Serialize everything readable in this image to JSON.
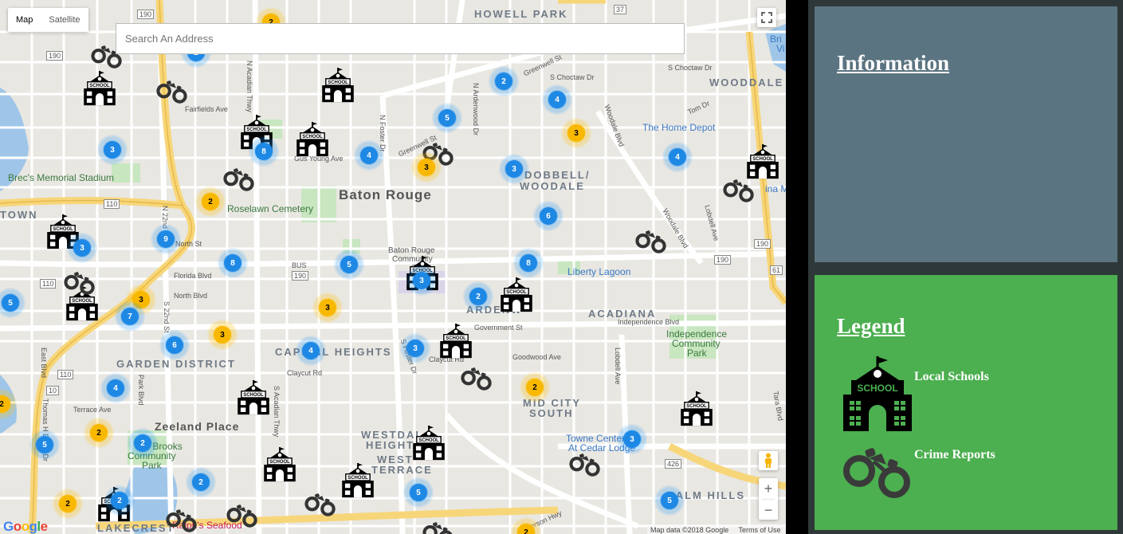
{
  "map": {
    "maptype_tabs": [
      {
        "label": "Map",
        "active": true
      },
      {
        "label": "Satellite",
        "active": false
      }
    ],
    "search": {
      "placeholder": "Search An Address",
      "value": ""
    },
    "zoom_in": "+",
    "zoom_out": "−",
    "attribution": {
      "data": "Map data ©2018 Google",
      "terms": "Terms of Use"
    },
    "google_logo": "Google",
    "labels": {
      "howell_park": "HOWELL PARK",
      "woodale": "WOODDALE",
      "baton_rouge": "Baton Rouge",
      "brecs": "Brec's Memorial Stadium",
      "roselawn": "Roselawn Cemetery",
      "home_depot": "The Home Depot",
      "bri": "Bri",
      "vi": "Vi",
      "ina_mall": "ina Mall",
      "town": "TOWN",
      "liberty_lagoon": "Liberty Lagoon",
      "ardenwood": "ARDENW",
      "acadiana": "ACADIANA",
      "independence_park_1": "Independence",
      "independence_park_2": "Community",
      "independence_park_3": "Park",
      "capital_heights": "CAPITAL HEIGHTS",
      "garden_district": "GARDEN DISTRICT",
      "mid_city_south_1": "MID CITY",
      "mid_city_south_2": "SOUTH",
      "zeeland_place": "Zeeland Place",
      "westdale_1": "WESTDAL",
      "westdale_2": "HEIGHT",
      "westdale_terrace_1": "WEST",
      "westdale_terrace_2": "TERRACE",
      "brooks_1": "Od Brooks",
      "brooks_2": "Community",
      "brooks_3": "Park",
      "towne_center": "Towne Center",
      "cedar_lodge": "At Cedar Lodge",
      "palm_hills": "PALM HILLS",
      "lakecrest": "LAKECREST",
      "seafood": "Ralph's Seafood",
      "dobbell_1": "DOBBELL/",
      "dobbell_2": "WOODALE",
      "br_cc_1": "Baton Rouge",
      "br_cc_2": "Community",
      "br_cc_3": "C",
      "fairfields": "Fairfields Ave",
      "gus_young": "Gus Young Ave",
      "north_st": "North St",
      "florida_blvd": "Florida Blvd",
      "north_blvd": "North Blvd",
      "government_st": "Government St",
      "goodwood": "Goodwood Ave",
      "claycut": "Claycut Rd",
      "claycut2": "Claycut Rd",
      "terrace_ave": "Terrace Ave",
      "s_choctaw": "S Choctaw Dr",
      "s_choctaw2": "S Choctaw Dr",
      "independence_blvd": "Independence Blvd",
      "greenwell": "Greenwell St",
      "greenwell2": "Greenwell St",
      "tom_dr": "Tom Dr",
      "n_foster": "N Foster Dr",
      "n_ardenwood": "N Ardenwood Dr",
      "woodale_blvd": "Woodale Blvd",
      "woodale_blvd2": "Woodale Blvd",
      "n_acadian": "N Acadian Thwy",
      "n_22nd": "N 22nd St",
      "s_22nd": "S 22nd St",
      "s_acadian": "S Acadian Thwy",
      "park_blvd": "Park Blvd",
      "east_blvd": "East Blvd",
      "thomas_delpit": "Thomas H Delpit Dr",
      "s_foster": "S Foster Dr",
      "lobdell": "Lobdell Ave",
      "lobdell2": "Lobdell Ave",
      "tara_blvd": "Tara Blvd",
      "jefferson": "Jefferson Hwy",
      "hwy_110": "110",
      "hwy_110b": "110",
      "hwy_110c": "110",
      "hwy_190a": "190",
      "hwy_190b": "190",
      "hwy_190c": "190",
      "hwy_190d": "190",
      "hwy_190e": "190",
      "hwy_61": "61",
      "hwy_426": "426",
      "hwy_10": "10",
      "hwy_37": "37",
      "hwy_bus": "BUS"
    },
    "clusters": [
      {
        "count": "2",
        "color": "yellow"
      },
      {
        "count": "2",
        "color": "blue"
      },
      {
        "count": "2",
        "color": "blue"
      },
      {
        "count": "4",
        "color": "blue"
      },
      {
        "count": "5",
        "color": "blue"
      },
      {
        "count": "3",
        "color": "yellow"
      },
      {
        "count": "3",
        "color": "blue"
      },
      {
        "count": "8",
        "color": "blue"
      },
      {
        "count": "4",
        "color": "blue"
      },
      {
        "count": "3",
        "color": "yellow"
      },
      {
        "count": "3",
        "color": "blue"
      },
      {
        "count": "4",
        "color": "blue"
      },
      {
        "count": "2",
        "color": "yellow"
      },
      {
        "count": "6",
        "color": "blue"
      },
      {
        "count": "9",
        "color": "blue"
      },
      {
        "count": "3",
        "color": "blue"
      },
      {
        "count": "8",
        "color": "blue"
      },
      {
        "count": "5",
        "color": "blue"
      },
      {
        "count": "8",
        "color": "blue"
      },
      {
        "count": "3",
        "color": "blue"
      },
      {
        "count": "2",
        "color": "blue"
      },
      {
        "count": "3",
        "color": "yellow"
      },
      {
        "count": "3",
        "color": "yellow"
      },
      {
        "count": "5",
        "color": "blue"
      },
      {
        "count": "7",
        "color": "blue"
      },
      {
        "count": "6",
        "color": "blue"
      },
      {
        "count": "3",
        "color": "yellow"
      },
      {
        "count": "4",
        "color": "blue"
      },
      {
        "count": "3",
        "color": "blue"
      },
      {
        "count": "4",
        "color": "blue"
      },
      {
        "count": "2",
        "color": "yellow"
      },
      {
        "count": "2",
        "color": "yellow"
      },
      {
        "count": "2",
        "color": "yellow"
      },
      {
        "count": "2",
        "color": "blue"
      },
      {
        "count": "5",
        "color": "blue"
      },
      {
        "count": "2",
        "color": "blue"
      },
      {
        "count": "2",
        "color": "yellow"
      },
      {
        "count": "2",
        "color": "blue"
      },
      {
        "count": "5",
        "color": "blue"
      },
      {
        "count": "3",
        "color": "blue"
      },
      {
        "count": "5",
        "color": "blue"
      },
      {
        "count": "2",
        "color": "yellow"
      }
    ],
    "school_markers_icon": "school-icon",
    "crime_markers_icon": "handcuffs-icon"
  },
  "panel": {
    "information_title": "Information",
    "legend_title": "Legend",
    "legend_items": [
      {
        "label": "Local Schools",
        "icon": "school-icon"
      },
      {
        "label": "Crime Reports",
        "icon": "handcuffs-icon"
      }
    ],
    "school_badge_text": "SCHOOL",
    "colors": {
      "information_bg": "#5b7481",
      "legend_bg": "#4caf50",
      "cluster_blue": "#1e88e5",
      "cluster_yellow": "#f9b800"
    }
  }
}
